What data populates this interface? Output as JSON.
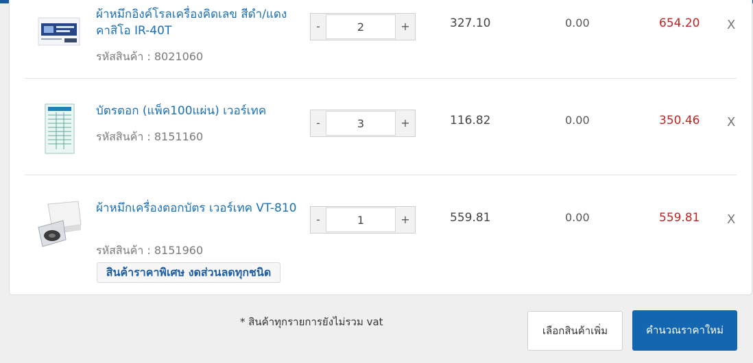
{
  "items": [
    {
      "name": "ผ้าหมึกอิงค์โรลเครื่องคิดเลข สีดำ/แดง คาสิโอ IR-40T",
      "sku_label": "รหัสสินค้า : ",
      "sku": "8021060",
      "qty": "2",
      "unit_price": "327.10",
      "discount": "0.00",
      "total": "654.20"
    },
    {
      "name": "บัตรตอก (แพ็ค100แผ่น) เวอร์เทค",
      "sku_label": "รหัสสินค้า : ",
      "sku": "8151160",
      "qty": "3",
      "unit_price": "116.82",
      "discount": "0.00",
      "total": "350.46"
    },
    {
      "name": "ผ้าหมึกเครื่องตอกบัตร เวอร์เทค VT-810",
      "sku_label": "รหัสสินค้า : ",
      "sku": "8151960",
      "qty": "1",
      "unit_price": "559.81",
      "discount": "0.00",
      "total": "559.81",
      "promo": "สินค้าราคาพิเศษ งดส่วนลดทุกชนิด"
    }
  ],
  "controls": {
    "minus": "-",
    "plus": "+",
    "remove": "X"
  },
  "footer": {
    "note": "* สินค้าทุกรายการยังไม่รวม vat",
    "more_button": "เลือกสินค้าเพิ่ม",
    "recalc_button": "คำนวณราคาใหม่"
  },
  "colors": {
    "accent": "#1466b0",
    "link": "#1a6fb5",
    "total": "#c62222"
  }
}
